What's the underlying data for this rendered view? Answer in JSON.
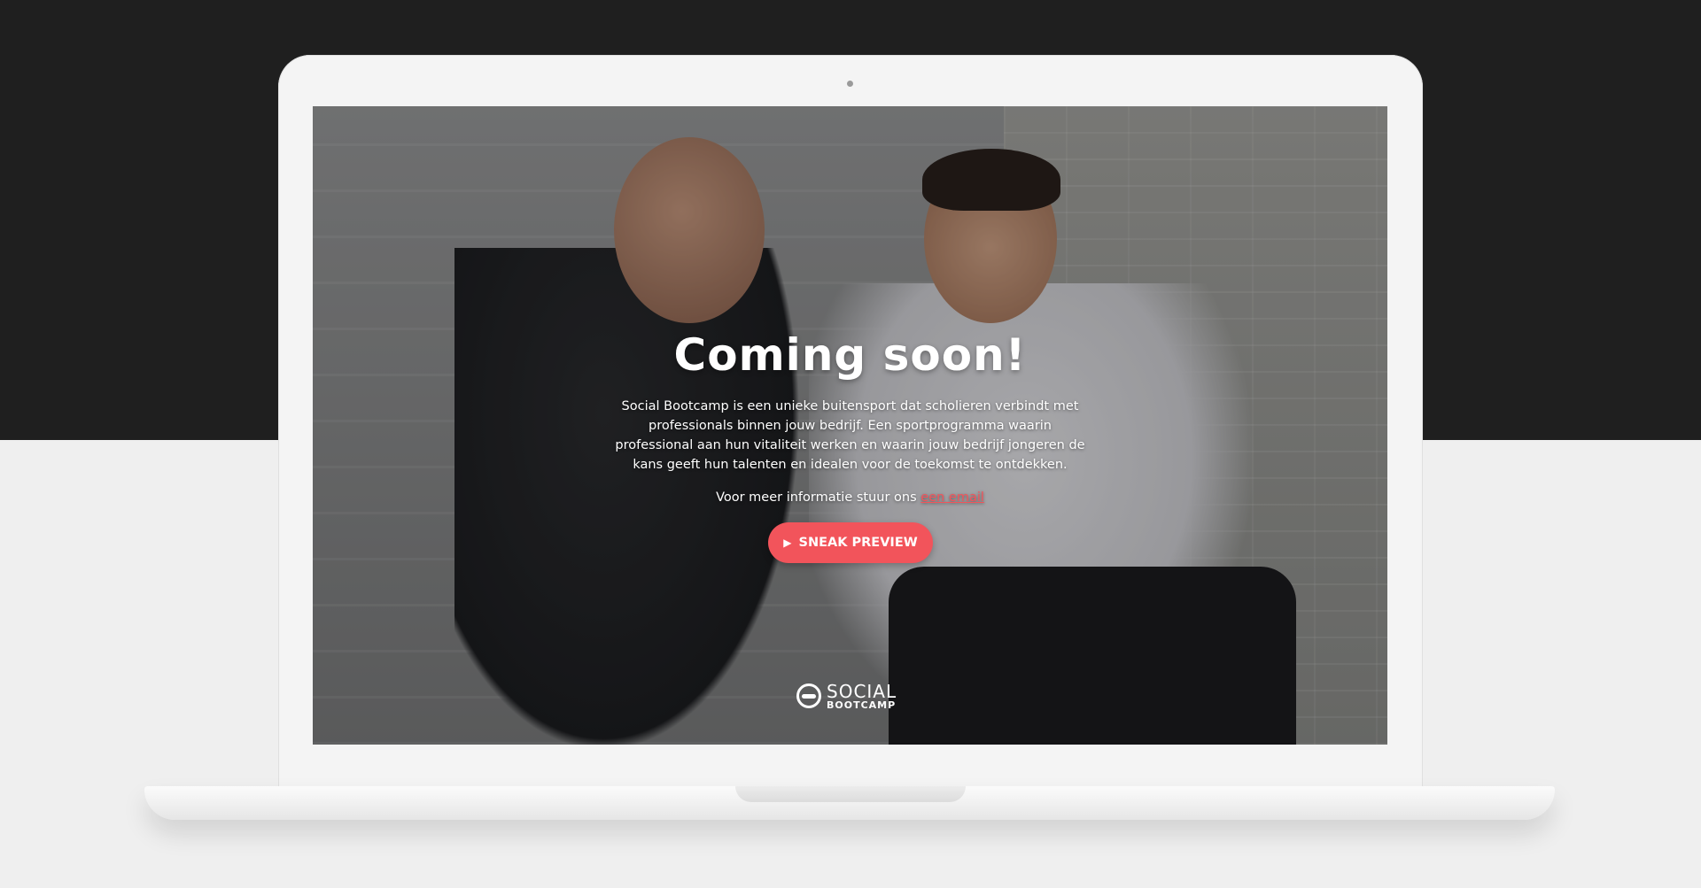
{
  "hero": {
    "headline": "Coming soon!",
    "intro": "Social Bootcamp is een unieke buitensport dat scholieren verbindt met professionals binnen jouw bedrijf. Een sportprogramma waarin professional aan hun vitaliteit werken en waarin jouw bedrijf jongeren de kans geeft hun talenten en idealen voor de toekomst te ontdekken.",
    "contact_prefix": "Voor meer informatie stuur ons ",
    "contact_link": "een email"
  },
  "cta": {
    "icon": "play-icon",
    "label": "SNEAK PREVIEW"
  },
  "logo": {
    "line1": "SOCIAL",
    "line2": "BOOTCAMP"
  },
  "colors": {
    "accent": "#f2545b",
    "background_dark": "#1f1f1f",
    "background_light": "#efefef"
  }
}
